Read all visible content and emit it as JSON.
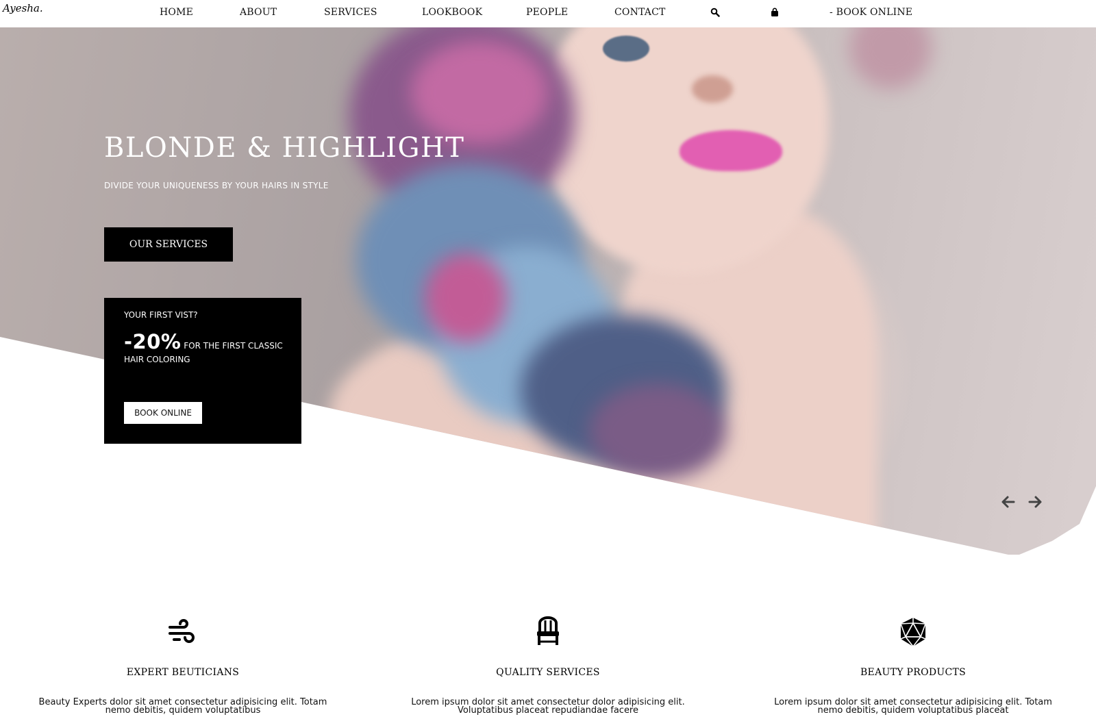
{
  "brand": {
    "logo": "Ayesha."
  },
  "nav": {
    "items": [
      "HOME",
      "ABOUT",
      "SERVICES",
      "LOOKBOOK",
      "PEOPLE",
      "CONTACT"
    ],
    "search_icon": "search-icon",
    "bag_icon": "shopping-bag-icon",
    "book_online": "- BOOK ONLINE"
  },
  "hero": {
    "title": "BLONDE & HIGHLIGHT",
    "subtitle": "DIVIDE YOUR UNIQUENESS BY YOUR HAIRS IN STYLE",
    "services_button": "OUR SERVICES",
    "promo": {
      "question": "YOUR FIRST VIST?",
      "discount": "-20%",
      "offer": " FOR THE FIRST CLASSIC HAIR COLORING",
      "button": "BOOK ONLINE"
    },
    "prev_icon": "arrow-left-icon",
    "next_icon": "arrow-right-icon"
  },
  "features": [
    {
      "icon": "wind-icon",
      "title": "EXPERT BEUTICIANS",
      "text": "Beauty Experts dolor sit amet consectetur adipisicing elit. Totam nemo debitis, quidem voluptatibus"
    },
    {
      "icon": "salon-chair-icon",
      "title": "QUALITY SERVICES",
      "text": "Lorem ipsum dolor sit amet consectetur dolor adipisicing elit. Voluptatibus placeat repudiandae facere"
    },
    {
      "icon": "gem-icon",
      "title": "BEAUTY PRODUCTS",
      "text": "Lorem ipsum dolor sit amet consectetur adipisicing elit. Totam nemo debitis, quidem voluptatibus placeat"
    }
  ],
  "colors": {
    "primary": "#000000",
    "background": "#ffffff",
    "hero_bg": "#b9aeac",
    "lip_accent": "#e25fb2"
  }
}
